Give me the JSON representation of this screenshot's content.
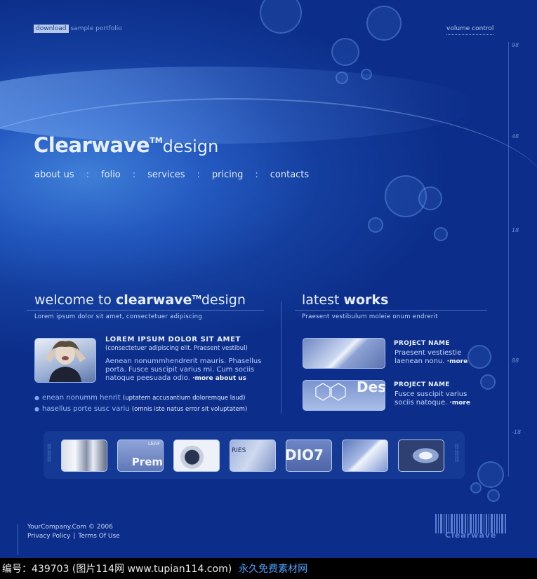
{
  "topbar": {
    "download": "download",
    "portfolio": "sample portfolio",
    "volume": "volume control"
  },
  "ruler": [
    "98",
    "48",
    "18",
    "88",
    "-18"
  ],
  "logo": {
    "brand": "Clearwave",
    "tm": "TM",
    "suffix": "design"
  },
  "nav": [
    "about us",
    "folio",
    "services",
    "pricing",
    "contacts"
  ],
  "nav_separator": ":",
  "welcome": {
    "title_pre": "welcome to ",
    "title_bold": "clearwave",
    "tm": "TM",
    "title_post": "design",
    "subtitle": "Lorem ipsum dolor sit amet, consectetuer adipiscing",
    "heading": "LOREM IPSUM DOLOR SIT AMET",
    "heading_small": "(consectetuer adipiscing elit. Praesent vestibul)",
    "body": "Aenean nonummhendrerit mauris. Phasellus porta. Fusce suscipit varius mi. Cum sociis natoque peesuada odio.",
    "more": "more about us",
    "bullets": [
      {
        "text": "enean nonumm henrit",
        "small": "(uptatem accusantium doloremque laud)"
      },
      {
        "text": "hasellus porte susc variu",
        "small": "(omnis iste natus error sit voluptatem)"
      }
    ]
  },
  "works": {
    "title_pre": "latest ",
    "title_bold": "works",
    "subtitle": "Praesent vestibulum moleie onum endrerit",
    "projects": [
      {
        "name": "PROJECT NAME",
        "line1": "Praesent vestiestie",
        "line2": "laenean nonu.",
        "more": "more"
      },
      {
        "name": "PROJECT NAME",
        "line1": "Fusce suscipit varius",
        "line2": "sociis natoque.",
        "more": "more"
      }
    ],
    "thumb2_text": "Des"
  },
  "gallery": [
    {
      "label": "",
      "icon": "lens-thumb"
    },
    {
      "label": "Prem",
      "top": "LEAF",
      "icon": "brochure-thumb"
    },
    {
      "label": "",
      "icon": "spiral-thumb"
    },
    {
      "label": "RIES",
      "icon": "architecture-thumb"
    },
    {
      "label": "DIO7",
      "icon": "studio-thumb"
    },
    {
      "label": "",
      "icon": "swoosh-thumb"
    },
    {
      "label": "",
      "icon": "shield-thumb"
    }
  ],
  "footer": {
    "copyright": "YourCompany.Com © 2006",
    "privacy": "Privacy Policy",
    "terms": "Terms Of Use",
    "barcode_text": "Clearwave"
  },
  "watermark": {
    "text": "编号：439703 (图片114网 www.tupian114.com)",
    "free": "永久免费素材网"
  }
}
